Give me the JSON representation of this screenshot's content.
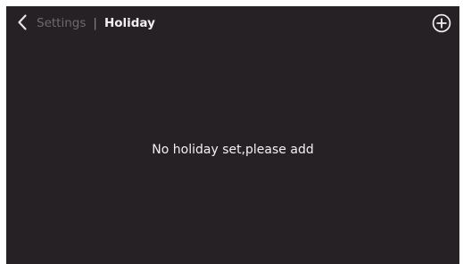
{
  "header": {
    "parent": "Settings",
    "separator": "|",
    "title": "Holiday",
    "back_icon": "chevron-left-icon",
    "add_icon": "plus-circle-icon"
  },
  "main": {
    "empty_message": "No holiday set,please add"
  },
  "colors": {
    "background": "#262124",
    "text_primary": "#f1eef0",
    "text_muted": "#6f6a6d"
  }
}
